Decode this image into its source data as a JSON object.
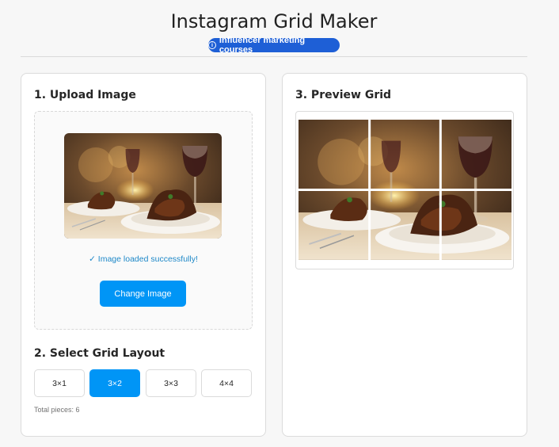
{
  "header": {
    "title": "Instagram Grid Maker",
    "badge_label": "Influencer marketing courses"
  },
  "upload": {
    "section_title": "1. Upload Image",
    "status": "✓ Image loaded successfully!",
    "change_button": "Change Image"
  },
  "layout": {
    "section_title": "2. Select Grid Layout",
    "options": [
      "3×1",
      "3×2",
      "3×3",
      "4×4"
    ],
    "selected": "3×2",
    "total_pieces": "Total pieces: 6"
  },
  "preview": {
    "section_title": "3. Preview Grid",
    "columns": 3,
    "rows": 2
  },
  "colors": {
    "accent": "#0095f6",
    "badge": "#1e5fd6",
    "success_text": "#1e88c8"
  }
}
